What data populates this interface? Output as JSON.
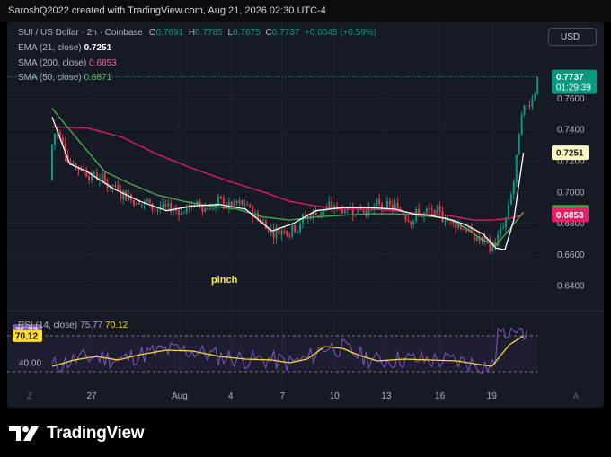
{
  "header": {
    "text": "SaroshQ2022 created with TradingView.com, Aug 21, 2026 02:30 UTC-4"
  },
  "legend": {
    "symbol": "SUI / US Dollar · 2h · Coinbase",
    "o_label": "O",
    "o": "0.7691",
    "h_label": "H",
    "h": "0.7785",
    "l_label": "L",
    "l": "0.7675",
    "c_label": "C",
    "c": "0.7737",
    "change": "+0.0045 (+0.59%)",
    "ema_label": "EMA (21, close)",
    "ema_value": "0.7251",
    "sma200_label": "SMA (200, close)",
    "sma200_value": "0.6853",
    "sma50_label": "SMA (50, close)",
    "sma50_value": "0.6871"
  },
  "currency_button": "USD",
  "annotation": "pinch",
  "price_axis": {
    "ticks": [
      "0.7600",
      "0.7400",
      "0.7200",
      "0.7000",
      "0.6800",
      "0.6600",
      "0.6400"
    ],
    "last_price": "0.7737",
    "countdown": "01:29:39",
    "ema_tag": "0.7251",
    "sma50_tag": "0.6871",
    "sma200_tag": "0.6853"
  },
  "time_axis": {
    "ticks": [
      "27",
      "Aug",
      "4",
      "7",
      "10",
      "13",
      "16",
      "19"
    ],
    "left_button": "Z",
    "right_button": "A"
  },
  "rsi": {
    "label": "RSI (14, close)",
    "rsi_value": "75.77",
    "ma_value": "70.12",
    "tag_rsi": "75.77",
    "tag_ma": "70.12",
    "level_label": "40.00"
  },
  "brand": "TradingView",
  "colors": {
    "up": "#089981",
    "down": "#f23645",
    "ema": "#ffffff",
    "sma200": "#e91e63",
    "sma50": "#4caf50",
    "rsi": "#7e57c2",
    "rsi_ma": "#fdd835",
    "background": "#161a25"
  },
  "chart_data": [
    {
      "type": "candlestick",
      "title": "SUI / US Dollar · 2h · Coinbase",
      "ylim": [
        0.628,
        0.789
      ],
      "x_ticks": [
        "27",
        "Aug",
        "4",
        "7",
        "10",
        "13",
        "16",
        "19"
      ],
      "series": [
        {
          "name": "SUI / US Dollar",
          "ohlc_last": {
            "o": 0.7691,
            "h": 0.7785,
            "l": 0.7675,
            "c": 0.7737
          }
        },
        {
          "name": "EMA (21, close)",
          "x": [
            0,
            20,
            40,
            70,
            100,
            130,
            160,
            190,
            220,
            250,
            275,
            300,
            330,
            360,
            390,
            410,
            430,
            455,
            470,
            490,
            505,
            515,
            525,
            536
          ],
          "values": [
            0.748,
            0.718,
            0.713,
            0.702,
            0.694,
            0.688,
            0.691,
            0.692,
            0.689,
            0.675,
            0.68,
            0.688,
            0.69,
            0.69,
            0.689,
            0.686,
            0.685,
            0.682,
            0.679,
            0.673,
            0.664,
            0.663,
            0.682,
            0.7251
          ]
        },
        {
          "name": "SMA (50, close)",
          "x": [
            0,
            30,
            60,
            90,
            120,
            150,
            180,
            210,
            240,
            270,
            300,
            330,
            360,
            390,
            420,
            450,
            470,
            490,
            505,
            520,
            536
          ],
          "values": [
            0.7535,
            0.733,
            0.713,
            0.705,
            0.698,
            0.694,
            0.691,
            0.689,
            0.684,
            0.682,
            0.684,
            0.685,
            0.686,
            0.686,
            0.685,
            0.683,
            0.677,
            0.669,
            0.666,
            0.676,
            0.6871
          ]
        },
        {
          "name": "SMA (200, close)",
          "x": [
            0,
            40,
            80,
            120,
            160,
            200,
            240,
            270,
            300,
            330,
            360,
            390,
            420,
            450,
            480,
            500,
            520,
            536
          ],
          "values": [
            0.7416,
            0.741,
            0.735,
            0.724,
            0.715,
            0.707,
            0.7,
            0.694,
            0.691,
            0.689,
            0.689,
            0.688,
            0.686,
            0.685,
            0.682,
            0.682,
            0.683,
            0.6853
          ]
        }
      ]
    },
    {
      "type": "line",
      "title": "RSI (14, close)",
      "ylim": [
        24,
        92
      ],
      "levels": [
        70,
        30
      ],
      "series": [
        {
          "name": "RSI (14, close)",
          "last": 75.77
        },
        {
          "name": "RSI-based MA",
          "x": [
            0,
            25,
            50,
            75,
            100,
            130,
            160,
            190,
            220,
            250,
            270,
            290,
            310,
            330,
            350,
            370,
            400,
            430,
            460,
            480,
            500,
            520,
            536
          ],
          "values": [
            36,
            43,
            47,
            43,
            49,
            54,
            53,
            47,
            44,
            43,
            40,
            44,
            58,
            56,
            48,
            42,
            44,
            43,
            42,
            39,
            36,
            60,
            70.12
          ]
        }
      ]
    }
  ]
}
